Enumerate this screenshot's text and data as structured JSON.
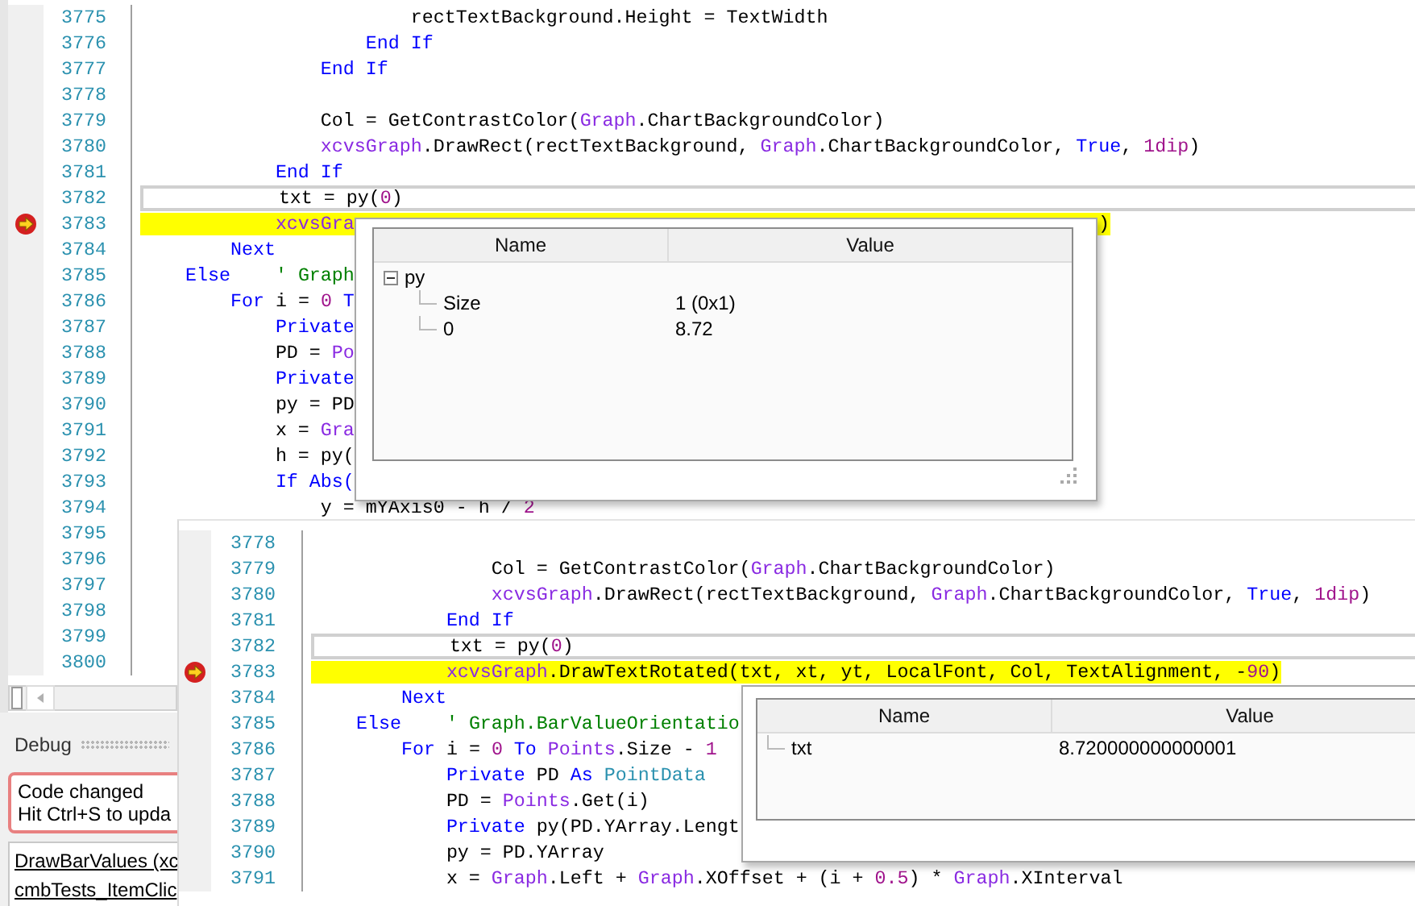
{
  "editor": {
    "lines": [
      {
        "number": "3775",
        "current": false,
        "executing": false,
        "breakpoint": false,
        "segments": [
          {
            "kind": "plain",
            "text": "                        rectTextBackground.Height = TextWidth"
          }
        ]
      },
      {
        "number": "3776",
        "current": false,
        "executing": false,
        "breakpoint": false,
        "segments": [
          {
            "kind": "keyword",
            "text": "                    End If"
          }
        ]
      },
      {
        "number": "3777",
        "current": false,
        "executing": false,
        "breakpoint": false,
        "segments": [
          {
            "kind": "keyword",
            "text": "                End If"
          }
        ]
      },
      {
        "number": "3778",
        "current": false,
        "executing": false,
        "breakpoint": false
      },
      {
        "number": "3779",
        "current": false,
        "executing": false,
        "breakpoint": false,
        "segments": [
          {
            "kind": "plain",
            "text": "                Col = GetContrastColor("
          },
          {
            "kind": "member",
            "text": "Graph"
          },
          {
            "kind": "plain",
            "text": ".ChartBackgroundColor)"
          }
        ]
      },
      {
        "number": "3780",
        "current": false,
        "executing": false,
        "breakpoint": false,
        "segments": [
          {
            "kind": "member",
            "text": "                xcvsGraph"
          },
          {
            "kind": "plain",
            "text": ".DrawRect(rectTextBackground, "
          },
          {
            "kind": "member",
            "text": "Graph"
          },
          {
            "kind": "plain",
            "text": ".ChartBackgroundColor, "
          },
          {
            "kind": "keyword",
            "text": "True"
          },
          {
            "kind": "plain",
            "text": ", "
          },
          {
            "kind": "number",
            "text": "1dip"
          },
          {
            "kind": "plain",
            "text": ")"
          }
        ]
      },
      {
        "number": "3781",
        "current": false,
        "executing": false,
        "breakpoint": false,
        "segments": [
          {
            "kind": "keyword",
            "text": "            End If"
          }
        ]
      },
      {
        "number": "3782",
        "current": true,
        "executing": false,
        "breakpoint": false,
        "segments": [
          {
            "kind": "plain",
            "text": "            txt = py("
          },
          {
            "kind": "number",
            "text": "0"
          },
          {
            "kind": "plain",
            "text": ")"
          }
        ]
      },
      {
        "number": "3783",
        "current": false,
        "executing": true,
        "breakpoint": true,
        "segments": [
          {
            "kind": "member",
            "text": "            xcvsGra"
          }
        ],
        "tail": ")"
      },
      {
        "number": "3784",
        "current": false,
        "executing": false,
        "breakpoint": false,
        "segments": [
          {
            "kind": "keyword",
            "text": "        Next"
          }
        ]
      },
      {
        "number": "3785",
        "current": false,
        "executing": false,
        "breakpoint": false,
        "segments": [
          {
            "kind": "keyword",
            "text": "    Else"
          },
          {
            "kind": "comment",
            "text": "    ' Graph"
          }
        ]
      },
      {
        "number": "3786",
        "current": false,
        "executing": false,
        "breakpoint": false,
        "segments": [
          {
            "kind": "keyword",
            "text": "        For"
          },
          {
            "kind": "plain",
            "text": " i = "
          },
          {
            "kind": "number",
            "text": "0"
          },
          {
            "kind": "keyword",
            "text": " T"
          }
        ]
      },
      {
        "number": "3787",
        "current": false,
        "executing": false,
        "breakpoint": false,
        "segments": [
          {
            "kind": "keyword",
            "text": "            Private"
          }
        ]
      },
      {
        "number": "3788",
        "current": false,
        "executing": false,
        "breakpoint": false,
        "segments": [
          {
            "kind": "plain",
            "text": "            PD = "
          },
          {
            "kind": "member",
            "text": "Po"
          }
        ]
      },
      {
        "number": "3789",
        "current": false,
        "executing": false,
        "breakpoint": false,
        "segments": [
          {
            "kind": "keyword",
            "text": "            Private"
          }
        ]
      },
      {
        "number": "3790",
        "current": false,
        "executing": false,
        "breakpoint": false,
        "segments": [
          {
            "kind": "plain",
            "text": "            py = PD"
          }
        ]
      },
      {
        "number": "3791",
        "current": false,
        "executing": false,
        "breakpoint": false,
        "segments": [
          {
            "kind": "plain",
            "text": "            x = "
          },
          {
            "kind": "member",
            "text": "Gra"
          }
        ]
      },
      {
        "number": "3792",
        "current": false,
        "executing": false,
        "breakpoint": false,
        "segments": [
          {
            "kind": "plain",
            "text": "            h = py("
          }
        ]
      },
      {
        "number": "3793",
        "current": false,
        "executing": false,
        "breakpoint": false,
        "segments": [
          {
            "kind": "keyword",
            "text": "            If Abs("
          }
        ]
      },
      {
        "number": "3794",
        "current": false,
        "executing": false,
        "breakpoint": false,
        "segments": [
          {
            "kind": "plain",
            "text": "                y = mYAxis0 - h / "
          },
          {
            "kind": "number",
            "text": "2"
          }
        ]
      },
      {
        "number": "3795",
        "current": false,
        "executing": false,
        "breakpoint": false
      },
      {
        "number": "3796",
        "current": false,
        "executing": false,
        "breakpoint": false
      },
      {
        "number": "3797",
        "current": false,
        "executing": false,
        "breakpoint": false
      },
      {
        "number": "3798",
        "current": false,
        "executing": false,
        "breakpoint": false
      },
      {
        "number": "3799",
        "current": false,
        "executing": false,
        "breakpoint": false
      },
      {
        "number": "3800",
        "current": false,
        "executing": false,
        "breakpoint": false
      }
    ]
  },
  "watch_popup": {
    "columns": [
      "Name",
      "Value"
    ],
    "rows": [
      {
        "name": "py",
        "expanded": true,
        "children": [
          {
            "name": "Size",
            "value": "1 (0x1)"
          },
          {
            "name": "0",
            "value": "8.72"
          }
        ]
      }
    ]
  },
  "overlay_editor": {
    "lines": [
      {
        "number": "3778",
        "current": false,
        "executing": false,
        "breakpoint": false
      },
      {
        "number": "3779",
        "current": false,
        "executing": false,
        "breakpoint": false,
        "segments": [
          {
            "kind": "plain",
            "text": "                Col = GetContrastColor("
          },
          {
            "kind": "member",
            "text": "Graph"
          },
          {
            "kind": "plain",
            "text": ".ChartBackgroundColor)"
          }
        ]
      },
      {
        "number": "3780",
        "current": false,
        "executing": false,
        "breakpoint": false,
        "segments": [
          {
            "kind": "member",
            "text": "                xcvsGraph"
          },
          {
            "kind": "plain",
            "text": ".DrawRect(rectTextBackground, "
          },
          {
            "kind": "member",
            "text": "Graph"
          },
          {
            "kind": "plain",
            "text": ".ChartBackgroundColor, "
          },
          {
            "kind": "keyword",
            "text": "True"
          },
          {
            "kind": "plain",
            "text": ", "
          },
          {
            "kind": "number",
            "text": "1dip"
          },
          {
            "kind": "plain",
            "text": ")"
          }
        ]
      },
      {
        "number": "3781",
        "current": false,
        "executing": false,
        "breakpoint": false,
        "segments": [
          {
            "kind": "keyword",
            "text": "            End If"
          }
        ]
      },
      {
        "number": "3782",
        "current": true,
        "executing": false,
        "breakpoint": false,
        "segments": [
          {
            "kind": "plain",
            "text": "            txt = py("
          },
          {
            "kind": "number",
            "text": "0"
          },
          {
            "kind": "plain",
            "text": ")"
          }
        ]
      },
      {
        "number": "3783",
        "current": false,
        "executing": true,
        "breakpoint": true,
        "segments": [
          {
            "kind": "member",
            "text": "            xcvsGraph"
          },
          {
            "kind": "plain",
            "text": ".DrawTextRotated(txt, xt, yt, LocalFont, Col, TextAlignment, -"
          },
          {
            "kind": "number",
            "text": "90"
          },
          {
            "kind": "plain",
            "text": ")"
          }
        ]
      },
      {
        "number": "3784",
        "current": false,
        "executing": false,
        "breakpoint": false,
        "segments": [
          {
            "kind": "keyword",
            "text": "        Next"
          }
        ]
      },
      {
        "number": "3785",
        "current": false,
        "executing": false,
        "breakpoint": false,
        "segments": [
          {
            "kind": "keyword",
            "text": "    Else"
          },
          {
            "kind": "comment",
            "text": "    ' Graph.BarValueOrientatio"
          }
        ]
      },
      {
        "number": "3786",
        "current": false,
        "executing": false,
        "breakpoint": false,
        "segments": [
          {
            "kind": "keyword",
            "text": "        For"
          },
          {
            "kind": "plain",
            "text": " i = "
          },
          {
            "kind": "number",
            "text": "0"
          },
          {
            "kind": "keyword",
            "text": " To"
          },
          {
            "kind": "member",
            "text": " Points"
          },
          {
            "kind": "plain",
            "text": ".Size - "
          },
          {
            "kind": "number",
            "text": "1"
          }
        ]
      },
      {
        "number": "3787",
        "current": false,
        "executing": false,
        "breakpoint": false,
        "segments": [
          {
            "kind": "keyword",
            "text": "            Private"
          },
          {
            "kind": "plain",
            "text": " PD "
          },
          {
            "kind": "keyword",
            "text": "As"
          },
          {
            "kind": "type",
            "text": " PointData"
          }
        ]
      },
      {
        "number": "3788",
        "current": false,
        "executing": false,
        "breakpoint": false,
        "segments": [
          {
            "kind": "plain",
            "text": "            PD = "
          },
          {
            "kind": "member",
            "text": "Points"
          },
          {
            "kind": "plain",
            "text": ".Get(i)"
          }
        ]
      },
      {
        "number": "3789",
        "current": false,
        "executing": false,
        "breakpoint": false,
        "segments": [
          {
            "kind": "keyword",
            "text": "            Private"
          },
          {
            "kind": "plain",
            "text": " py(PD.YArray.Lengt"
          }
        ]
      },
      {
        "number": "3790",
        "current": false,
        "executing": false,
        "breakpoint": false,
        "segments": [
          {
            "kind": "plain",
            "text": "            py = PD.YArray"
          }
        ]
      },
      {
        "number": "3791",
        "current": false,
        "executing": false,
        "breakpoint": false,
        "segments": [
          {
            "kind": "plain",
            "text": "            x = "
          },
          {
            "kind": "member",
            "text": "Graph"
          },
          {
            "kind": "plain",
            "text": ".Left + "
          },
          {
            "kind": "member",
            "text": "Graph"
          },
          {
            "kind": "plain",
            "text": ".XOffset + (i + "
          },
          {
            "kind": "number",
            "text": "0.5"
          },
          {
            "kind": "plain",
            "text": ") * "
          },
          {
            "kind": "member",
            "text": "Graph"
          },
          {
            "kind": "plain",
            "text": ".XInterval"
          }
        ]
      }
    ]
  },
  "overlay_watch_popup": {
    "columns": [
      "Name",
      "Value"
    ],
    "rows": [
      {
        "name": "txt",
        "value": "8.720000000000001"
      }
    ]
  },
  "debug_panel": {
    "title": "Debug",
    "notice": [
      "Code changed",
      "Hit Ctrl+S to upda"
    ],
    "call_stack": [
      "DrawBarValues (xc",
      "cmbTests_ItemClic"
    ]
  }
}
